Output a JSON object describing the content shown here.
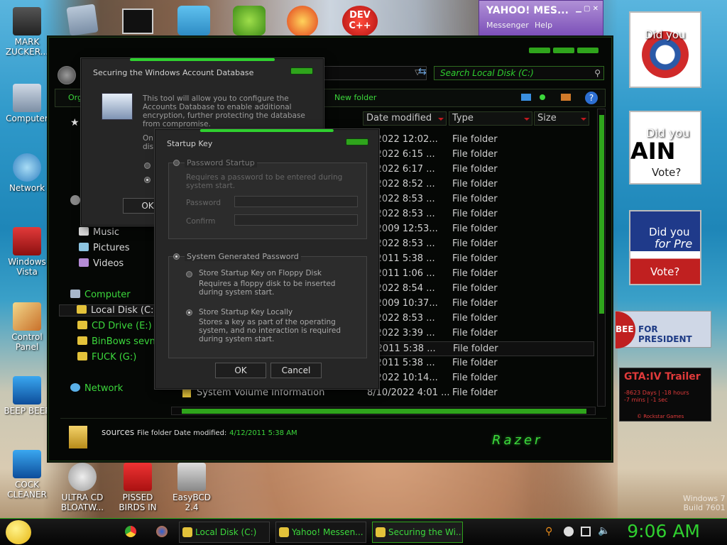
{
  "desktop": {
    "icons": [
      {
        "label": "MARK ZUCKER..."
      },
      {
        "label": "Computer"
      },
      {
        "label": "Network"
      },
      {
        "label": "Windows Vista"
      },
      {
        "label": "Control Panel"
      },
      {
        "label": "BEEP BEEP"
      },
      {
        "label": "COCK CLEANER"
      },
      {
        "label": "ULTRA CD BLOATW..."
      },
      {
        "label": "PISSED BIRDS IN"
      },
      {
        "label": "EasyBCD 2.4"
      }
    ],
    "top_icon_label": "DEV C++",
    "watermark": [
      "Windows 7",
      "Build 7601"
    ]
  },
  "yahoo": {
    "logo": "YAHOO! MES...",
    "menu": [
      "Messenger",
      "Help"
    ]
  },
  "gadgets": {
    "obama": {
      "text": "Did you"
    },
    "mccain": {
      "line1": "Did you",
      "line2": "AIN",
      "line3": "Vote?"
    },
    "vote3": {
      "line1": "Did you",
      "line2": "for Pre",
      "line3": "Vote?"
    },
    "huckabee": {
      "left": "BEE",
      "right": "FOR PRESIDENT"
    },
    "gta": {
      "title": "GTA:IV Trailer",
      "line1": "-8623 Days | -18 hours",
      "line2": "-7 mins | -1 sec",
      "footer": "© Rockstar Games"
    }
  },
  "explorer": {
    "search_placeholder": "Search Local Disk (C:)",
    "toolbar": {
      "organize": "Org",
      "new_folder": "New folder"
    },
    "columns": [
      "Date modified",
      "Type",
      "Size"
    ],
    "nav": {
      "music": "Music",
      "pictures": "Pictures",
      "videos": "Videos",
      "computer": "Computer",
      "local_disk": "Local Disk (C:)",
      "cd_drive": "CD Drive (E:)",
      "binbows": "BinBows sevne",
      "fuck": "FUCK (G:)",
      "network": "Network"
    },
    "rows": [
      {
        "name": "",
        "date": "0/2022 12:02...",
        "type": "File folder"
      },
      {
        "name": "",
        "date": "0/2022 6:15 ...",
        "type": "File folder"
      },
      {
        "name": "",
        "date": "0/2022 6:17 ...",
        "type": "File folder"
      },
      {
        "name": "",
        "date": "0/2022 8:52 ...",
        "type": "File folder"
      },
      {
        "name": "",
        "date": "0/2022 8:53 ...",
        "type": "File folder"
      },
      {
        "name": "",
        "date": "0/2022 8:53 ...",
        "type": "File folder"
      },
      {
        "name": "",
        "date": "4/2009 12:53...",
        "type": "File folder"
      },
      {
        "name": "",
        "date": "0/2022 8:53 ...",
        "type": "File folder"
      },
      {
        "name": "",
        "date": "2/2011 5:38 ...",
        "type": "File folder"
      },
      {
        "name": "",
        "date": "2/2011 1:06 ...",
        "type": "File folder"
      },
      {
        "name": "",
        "date": "0/2022 8:54 ...",
        "type": "File folder"
      },
      {
        "name": "",
        "date": "3/2009 10:37...",
        "type": "File folder"
      },
      {
        "name": "",
        "date": "0/2022 8:53 ...",
        "type": "File folder"
      },
      {
        "name": "",
        "date": "0/2022 3:39 ...",
        "type": "File folder"
      },
      {
        "name": "",
        "date": "2/2011 5:38 ...",
        "type": "File folder"
      },
      {
        "name": "",
        "date": "2/2011 5:38 ...",
        "type": "File folder"
      },
      {
        "name": "",
        "date": "0/2022 10:14...",
        "type": "File folder"
      },
      {
        "name": "System Volume Information",
        "date": "8/10/2022 4:01 ...",
        "type": "File folder"
      }
    ],
    "status": {
      "name": "sources",
      "desc": "File folder Date modified:",
      "date": "4/12/2011 5:38 AM"
    },
    "brand": "Razer"
  },
  "dialog_db": {
    "title": "Securing the Windows Account Database",
    "desc": "This tool will allow you to configure the Accounts Database to enable additional encryption, further protecting the database from compromise.",
    "partial": [
      "On",
      "dis"
    ],
    "ok": "OK"
  },
  "dialog_key": {
    "title": "Startup Key",
    "password_startup": "Password Startup",
    "password_startup_desc": "Requires a password to be entered during system start.",
    "password_label": "Password",
    "confirm_label": "Confirm",
    "system_generated": "System Generated Password",
    "floppy_title": "Store Startup Key on Floppy Disk",
    "floppy_desc": "Requires a floppy disk to be inserted during system start.",
    "local_title": "Store Startup Key Locally",
    "local_desc": "Stores a key as part of the operating system, and no interaction is required during system start.",
    "ok": "OK",
    "cancel": "Cancel"
  },
  "taskbar": {
    "buttons": [
      "Local Disk (C:)",
      "Yahoo! Messen...",
      "Securing the Wi..."
    ],
    "clock": "9:06 AM"
  }
}
